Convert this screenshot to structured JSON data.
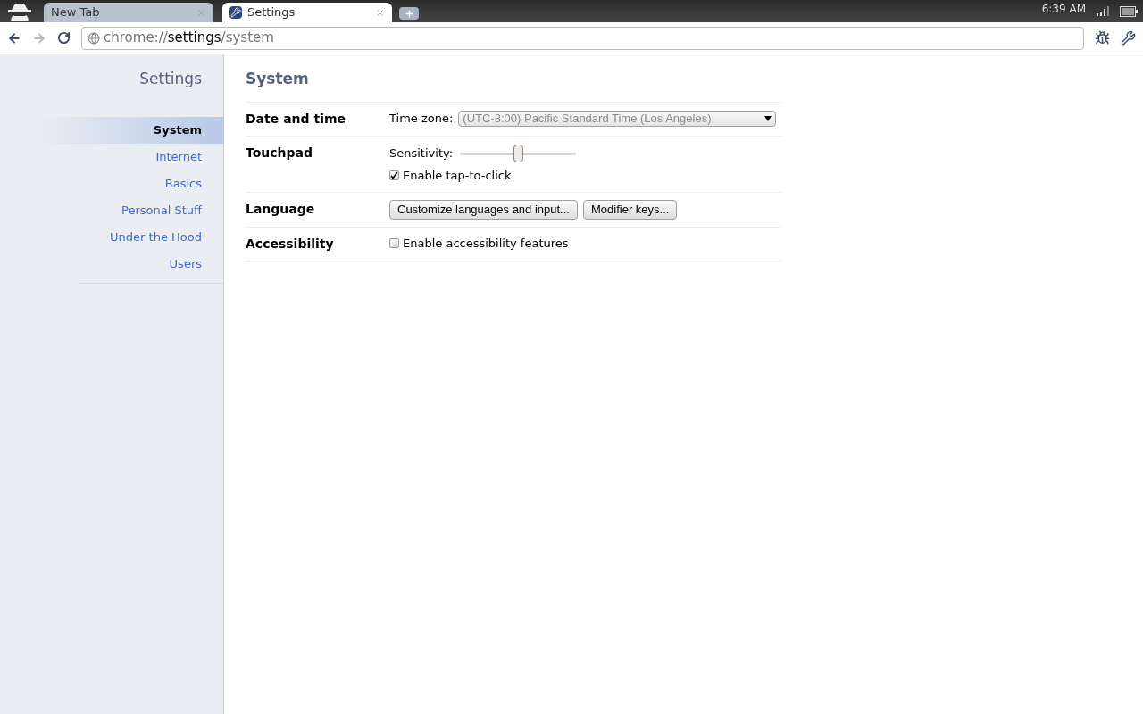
{
  "tabs": [
    {
      "label": "New Tab",
      "selected": false
    },
    {
      "label": "Settings",
      "selected": true
    }
  ],
  "status": {
    "time": "6:39 AM"
  },
  "address": {
    "scheme": "chrome://",
    "host": "settings",
    "path": "/system"
  },
  "sidebar": {
    "title": "Settings",
    "items": [
      {
        "label": "System",
        "selected": true
      },
      {
        "label": "Internet",
        "selected": false
      },
      {
        "label": "Basics",
        "selected": false
      },
      {
        "label": "Personal Stuff",
        "selected": false
      },
      {
        "label": "Under the Hood",
        "selected": false
      },
      {
        "label": "Users",
        "selected": false
      }
    ]
  },
  "page": {
    "title": "System",
    "sections": [
      {
        "title": "Date and time",
        "controls": [
          {
            "kind": "select",
            "label": "Time zone:",
            "value": "(UTC-8:00) Pacific Standard Time (Los Angeles)",
            "disabled": true
          }
        ]
      },
      {
        "title": "Touchpad",
        "controls": [
          {
            "kind": "slider",
            "label": "Sensitivity:",
            "level": 0.5
          },
          {
            "kind": "checkbox",
            "label": "Enable tap-to-click",
            "checked": true
          }
        ]
      },
      {
        "title": "Language",
        "controls": [
          {
            "kind": "buttons",
            "buttons": [
              "Customize languages and input...",
              "Modifier keys..."
            ]
          }
        ]
      },
      {
        "title": "Accessibility",
        "controls": [
          {
            "kind": "checkbox",
            "label": "Enable accessibility features",
            "checked": false
          }
        ]
      }
    ]
  }
}
